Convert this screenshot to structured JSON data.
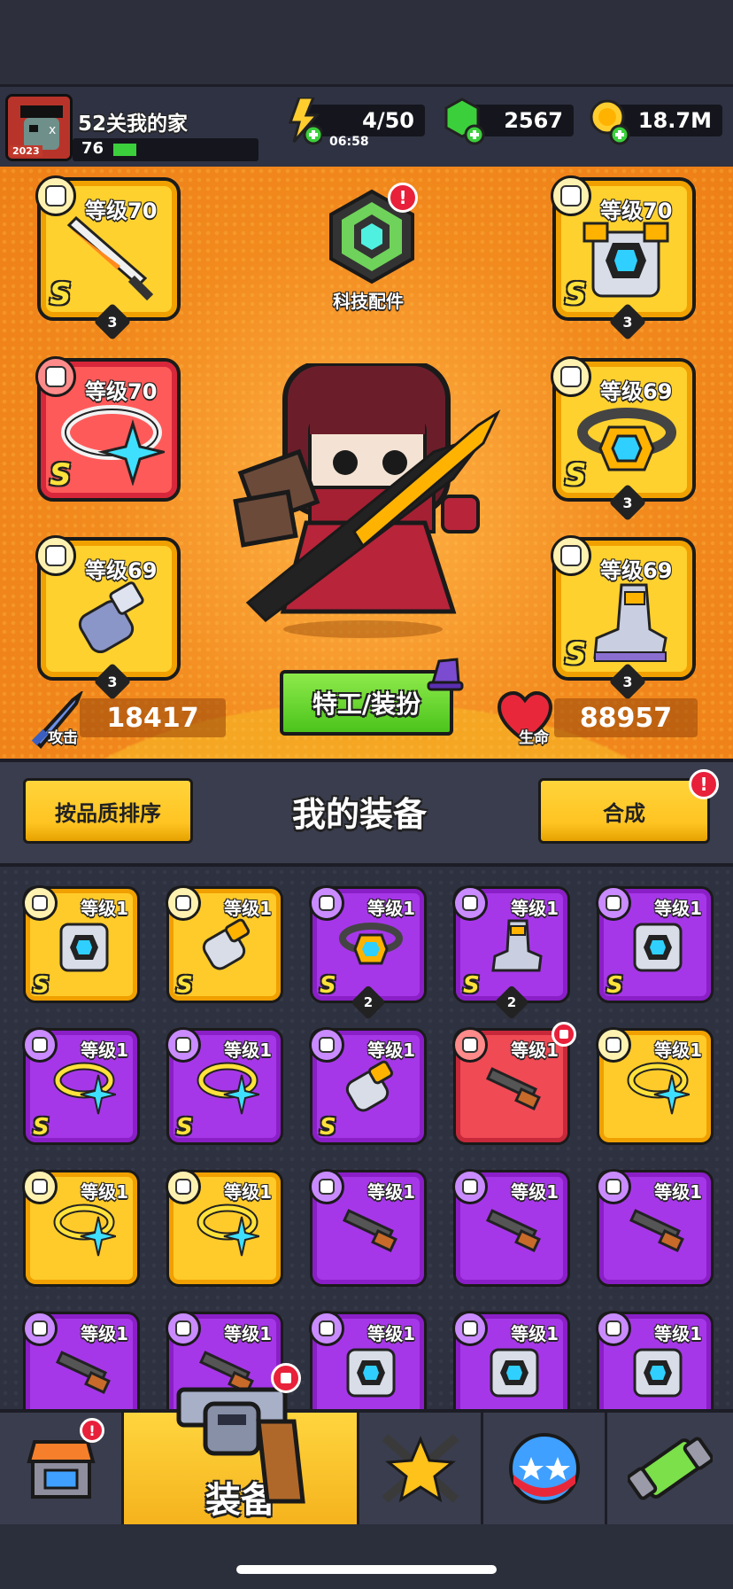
{
  "player": {
    "name": "52关我的家",
    "level": "76",
    "avatar_year": "2023"
  },
  "resources": {
    "energy": "4/50",
    "energy_timer": "06:58",
    "gems": "2567",
    "gold": "18.7M"
  },
  "equipped": {
    "left": [
      {
        "type": "weapon",
        "level": "等级70",
        "rank": "S",
        "stars": "3",
        "color": "yellow"
      },
      {
        "type": "necklace",
        "level": "等级70",
        "rank": "S",
        "stars": "",
        "color": "red"
      },
      {
        "type": "glove",
        "level": "等级69",
        "rank": "S",
        "stars": "3",
        "color": "yellow"
      }
    ],
    "right": [
      {
        "type": "armor",
        "level": "等级70",
        "rank": "S",
        "stars": "3",
        "color": "yellow"
      },
      {
        "type": "belt",
        "level": "等级69",
        "rank": "S",
        "stars": "3",
        "color": "yellow"
      },
      {
        "type": "boots",
        "level": "等级69",
        "rank": "S",
        "stars": "3",
        "color": "yellow"
      }
    ]
  },
  "tech_parts": {
    "label": "科技配件",
    "alert": "!"
  },
  "stats": {
    "attack_label": "攻击",
    "attack_value": "18417",
    "hp_label": "生命",
    "hp_value": "88957"
  },
  "agent_button": "特工/装扮",
  "section": {
    "sort_button": "按品质排序",
    "title": "我的装备",
    "merge_button": "合成",
    "merge_alert": "!"
  },
  "inventory": [
    {
      "type": "armor",
      "level": "等级1",
      "rank": "S",
      "stars": "",
      "color": "yellow"
    },
    {
      "type": "glove",
      "level": "等级1",
      "rank": "S",
      "stars": "",
      "color": "yellow"
    },
    {
      "type": "belt",
      "level": "等级1",
      "rank": "S",
      "stars": "2",
      "color": "purple"
    },
    {
      "type": "boots",
      "level": "等级1",
      "rank": "S",
      "stars": "2",
      "color": "purple"
    },
    {
      "type": "armor",
      "level": "等级1",
      "rank": "S",
      "stars": "",
      "color": "purple"
    },
    {
      "type": "necklace",
      "level": "等级1",
      "rank": "S",
      "stars": "",
      "color": "purple"
    },
    {
      "type": "necklace",
      "level": "等级1",
      "rank": "S",
      "stars": "",
      "color": "purple"
    },
    {
      "type": "glove",
      "level": "等级1",
      "rank": "S",
      "stars": "",
      "color": "purple"
    },
    {
      "type": "weapon",
      "level": "等级1",
      "rank": "",
      "stars": "",
      "color": "red"
    },
    {
      "type": "necklace",
      "level": "等级1",
      "rank": "",
      "stars": "",
      "color": "yellow"
    },
    {
      "type": "necklace",
      "level": "等级1",
      "rank": "",
      "stars": "",
      "color": "yellow"
    },
    {
      "type": "necklace",
      "level": "等级1",
      "rank": "",
      "stars": "",
      "color": "yellow"
    },
    {
      "type": "weapon",
      "level": "等级1",
      "rank": "",
      "stars": "",
      "color": "purple"
    },
    {
      "type": "weapon",
      "level": "等级1",
      "rank": "",
      "stars": "",
      "color": "purple"
    },
    {
      "type": "weapon",
      "level": "等级1",
      "rank": "",
      "stars": "",
      "color": "purple"
    },
    {
      "type": "weapon",
      "level": "等级1",
      "rank": "",
      "stars": "",
      "color": "purple"
    },
    {
      "type": "weapon",
      "level": "等级1",
      "rank": "",
      "stars": "",
      "color": "purple"
    },
    {
      "type": "armor",
      "level": "等级1",
      "rank": "",
      "stars": "",
      "color": "purple"
    },
    {
      "type": "armor",
      "level": "等级1",
      "rank": "",
      "stars": "",
      "color": "purple"
    },
    {
      "type": "armor",
      "level": "等级1",
      "rank": "",
      "stars": "",
      "color": "purple"
    }
  ],
  "nav": {
    "tabs": [
      "shop",
      "equipment",
      "battle",
      "pets",
      "gene"
    ],
    "active_label": "装备",
    "shop_alert": "!",
    "equip_alert": ""
  },
  "colors": {
    "yellow": "#ffcb2a",
    "purple": "#a637e8",
    "red": "#f04a55",
    "orange_bg": "#f28a1e"
  }
}
